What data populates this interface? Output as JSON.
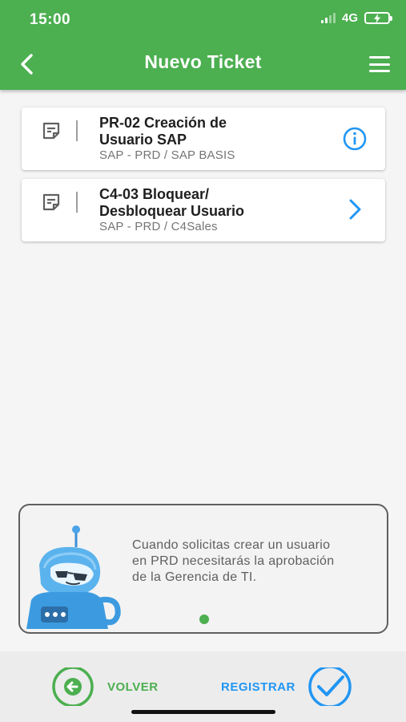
{
  "status_bar": {
    "time": "15:00",
    "network": "4G"
  },
  "header": {
    "title": "Nuevo Ticket",
    "back_icon": "chevron-left-icon",
    "menu_icon": "hamburger-menu-icon"
  },
  "tickets": [
    {
      "code_title": "PR-02 Creación de\nUsuario SAP",
      "subtitle": "SAP - PRD / SAP BASIS",
      "action_icon": "info-icon"
    },
    {
      "code_title": "C4-03 Bloquear/\nDesbloquear Usuario",
      "subtitle": "SAP - PRD / C4Sales",
      "action_icon": "chevron-right-icon"
    }
  ],
  "info_panel": {
    "message": "Cuando solicitas crear un usuario en PRD necesitarás la aprobación de la Gerencia de TI.",
    "pager_dots": 1,
    "active_dot": 1
  },
  "actions": {
    "back_label": "VOLVER",
    "register_label": "REGISTRAR"
  },
  "colors": {
    "primary": "#4caf50",
    "accent": "#2196f3",
    "muted_text": "#757575"
  }
}
